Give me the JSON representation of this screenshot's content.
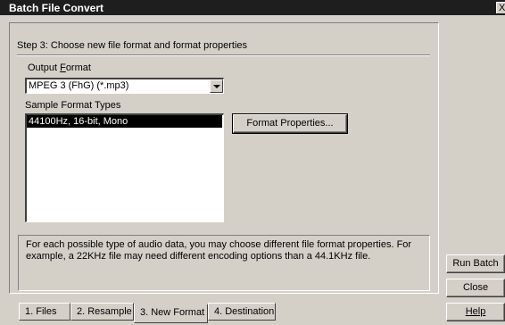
{
  "window": {
    "title": "Batch File Convert",
    "close_label": "X"
  },
  "step": {
    "title": "Step 3:  Choose new file format and format properties"
  },
  "output_format": {
    "label_pre": "Output ",
    "label_key": "F",
    "label_post": "ormat",
    "value": "MPEG 3 (FhG) (*.mp3)"
  },
  "sample_types": {
    "label": "Sample Format Types",
    "items": [
      "44100Hz, 16-bit, Mono"
    ],
    "selected_index": 0
  },
  "buttons": {
    "format_properties": "Format Properties...",
    "run_batch": "Run Batch",
    "close": "Close",
    "help": "Help"
  },
  "info_text": "For each possible type of audio data, you may choose different file format properties.  For example, a 22KHz file may need different encoding options than a 44.1KHz file.",
  "tabs": [
    {
      "label": "1. Files",
      "active": false
    },
    {
      "label": "2. Resample",
      "active": false
    },
    {
      "label": "3. New Format",
      "active": true
    },
    {
      "label": "4. Destination",
      "active": false
    }
  ]
}
